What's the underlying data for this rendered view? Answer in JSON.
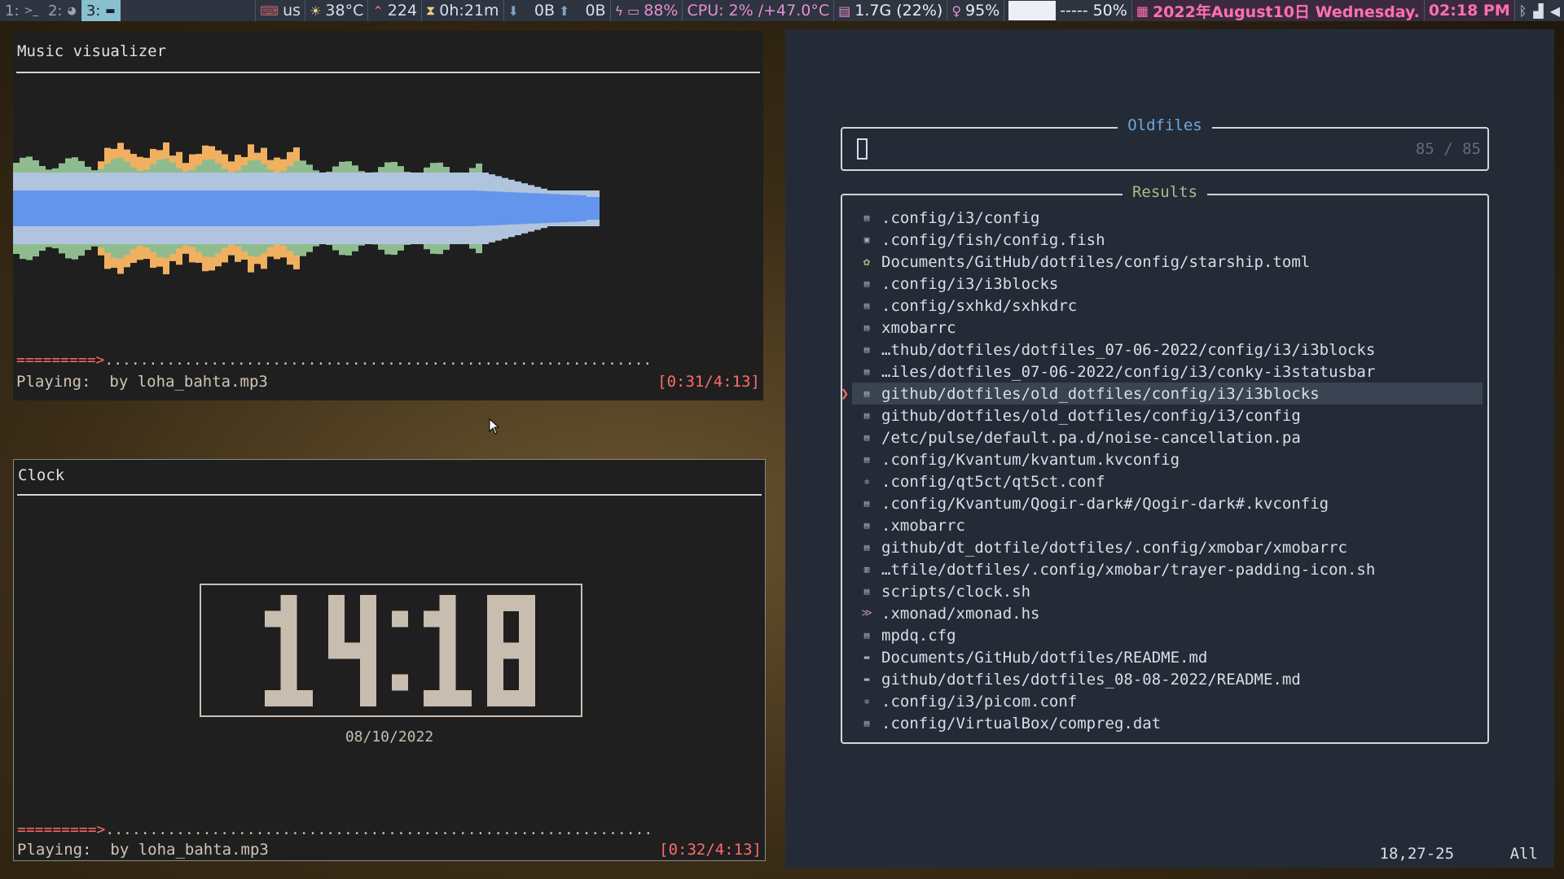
{
  "bar": {
    "workspaces": [
      {
        "num": "1:",
        "icon": ">_",
        "active": false
      },
      {
        "num": "2:",
        "icon": "◕",
        "active": false
      },
      {
        "num": "3:",
        "icon": "▬",
        "active": true
      }
    ],
    "keyboard_layout": "us",
    "temperature": "38°C",
    "updates": "224",
    "uptime": "0h:21m",
    "net_down": "0B",
    "net_up": "0B",
    "battery": "88%",
    "cpu": "CPU: 2% /+47.0°C",
    "memory": "1.7G (22%)",
    "brightness": "95%",
    "volume_bar": "----- 50%",
    "date": "2022年August10日 Wednesday.",
    "time": "02:18 PM"
  },
  "visualizer": {
    "title": "Music visualizer",
    "progress_arrow": "=========>",
    "progress_rest": "..............................................................",
    "playing_label": "Playing:",
    "track": "by loha_bahta.mp3",
    "timecode": "[0:31/4:13]",
    "colors": {
      "bass": "#6495ed",
      "mid": "#b0c4de",
      "treble": "#8fbc8f",
      "high": "#f0b060"
    }
  },
  "clock": {
    "title": "Clock",
    "time": "14:18",
    "date": "08/10/2022",
    "progress_arrow": "=========>",
    "progress_rest": "..............................................................",
    "playing_label": "Playing:",
    "track": "by loha_bahta.mp3",
    "timecode": "[0:32/4:13]"
  },
  "telescope": {
    "prompt_title": "Oldfiles",
    "prompt_icon": "",
    "count": "85 / 85",
    "results_title": "Results",
    "selected_index": 8,
    "results": [
      {
        "icon": "file",
        "path": ".config/i3/config"
      },
      {
        "icon": "fish",
        "path": ".config/fish/config.fish"
      },
      {
        "icon": "gear",
        "path": "Documents/GitHub/dotfiles/config/starship.toml"
      },
      {
        "icon": "file",
        "path": ".config/i3/i3blocks"
      },
      {
        "icon": "file",
        "path": ".config/sxhkd/sxhkdrc"
      },
      {
        "icon": "file",
        "path": "xmobarrc"
      },
      {
        "icon": "file",
        "path": "…thub/dotfiles/dotfiles_07-06-2022/config/i3/i3blocks"
      },
      {
        "icon": "file",
        "path": "…iles/dotfiles_07-06-2022/config/i3/conky-i3statusbar"
      },
      {
        "icon": "file",
        "path": "github/dotfiles/old_dotfiles/config/i3/i3blocks"
      },
      {
        "icon": "file",
        "path": "github/dotfiles/old_dotfiles/config/i3/config"
      },
      {
        "icon": "file",
        "path": "/etc/pulse/default.pa.d/noise-cancellation.pa"
      },
      {
        "icon": "file",
        "path": ".config/Kvantum/kvantum.kvconfig"
      },
      {
        "icon": "cog",
        "path": ".config/qt5ct/qt5ct.conf"
      },
      {
        "icon": "file",
        "path": ".config/Kvantum/Qogir-dark#/Qogir-dark#.kvconfig"
      },
      {
        "icon": "file",
        "path": ".xmobarrc"
      },
      {
        "icon": "file",
        "path": "github/dt_dotfile/dotfiles/.config/xmobar/xmobarrc"
      },
      {
        "icon": "term",
        "path": "…tfile/dotfiles/.config/xmobar/trayer-padding-icon.sh"
      },
      {
        "icon": "file",
        "path": "scripts/clock.sh"
      },
      {
        "icon": "haskell",
        "path": ".xmonad/xmonad.hs"
      },
      {
        "icon": "file",
        "path": "mpdq.cfg"
      },
      {
        "icon": "md",
        "path": "Documents/GitHub/dotfiles/README.md"
      },
      {
        "icon": "md",
        "path": "github/dotfiles/dotfiles_08-08-2022/README.md"
      },
      {
        "icon": "cog",
        "path": ".config/i3/picom.conf"
      },
      {
        "icon": "file",
        "path": ".config/VirtualBox/compreg.dat"
      }
    ],
    "status_position": "18,27-25",
    "status_scroll": "All"
  }
}
